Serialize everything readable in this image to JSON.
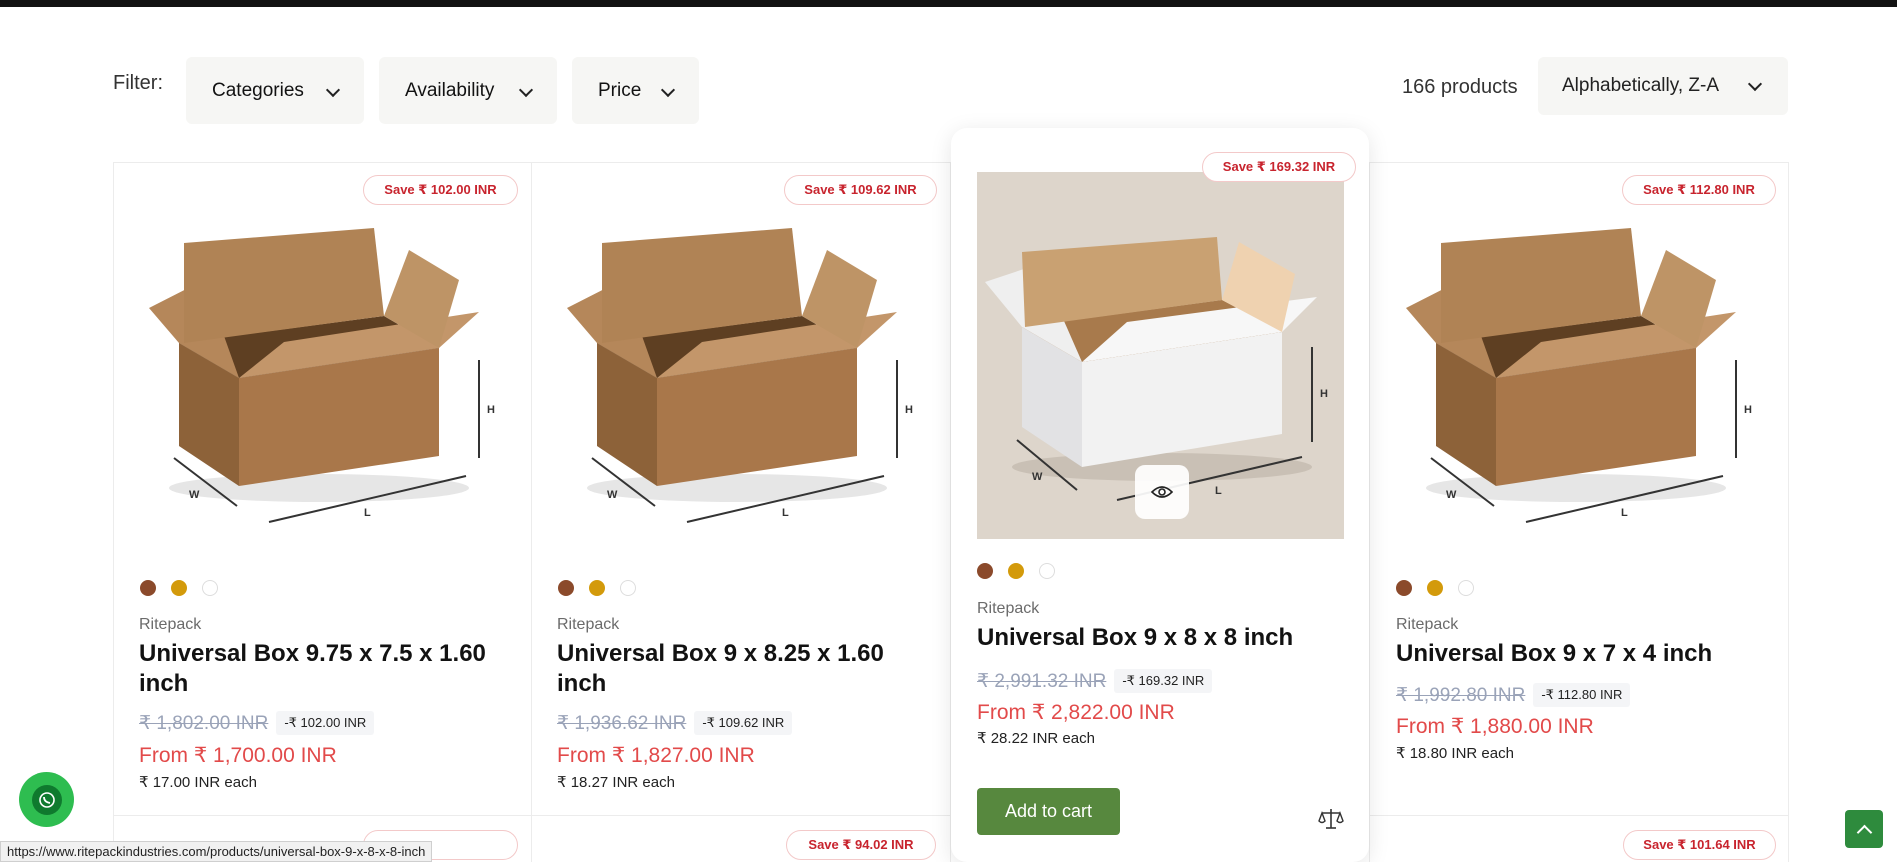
{
  "filter": {
    "label": "Filter:",
    "buttons": [
      {
        "label": "Categories"
      },
      {
        "label": "Availability"
      },
      {
        "label": "Price"
      }
    ]
  },
  "product_count": "166 products",
  "sort": {
    "selected": "Alphabetically, Z-A"
  },
  "products": [
    {
      "badge": "Save ₹ 102.00 INR",
      "vendor": "Ritepack",
      "title": "Universal Box 9.75 x 7.5 x 1.60 inch",
      "compare_price": "₹ 1,802.00 INR",
      "discount": "-₹ 102.00 INR",
      "price": "From ₹ 1,700.00 INR",
      "unit_price": "₹ 17.00 INR each",
      "box_color": "brown"
    },
    {
      "badge": "Save ₹ 109.62 INR",
      "vendor": "Ritepack",
      "title": "Universal Box 9 x 8.25 x 1.60 inch",
      "compare_price": "₹ 1,936.62 INR",
      "discount": "-₹ 109.62 INR",
      "price": "From ₹ 1,827.00 INR",
      "unit_price": "₹ 18.27 INR each",
      "box_color": "brown"
    },
    {
      "badge": "Save ₹ 169.32 INR",
      "vendor": "Ritepack",
      "title": "Universal Box 9 x 8 x 8 inch",
      "compare_price": "₹ 2,991.32 INR",
      "discount": "-₹ 169.32 INR",
      "price": "From ₹ 2,822.00 INR",
      "unit_price": "₹ 28.22 INR each",
      "box_color": "white",
      "add_to_cart": "Add to cart"
    },
    {
      "badge": "Save ₹ 112.80 INR",
      "vendor": "Ritepack",
      "title": "Universal Box 9 x 7 x 4 inch",
      "compare_price": "₹ 1,992.80 INR",
      "discount": "-₹ 112.80 INR",
      "price": "From ₹ 1,880.00 INR",
      "unit_price": "₹ 18.80 INR each",
      "box_color": "brown"
    }
  ],
  "next_row_badges": [
    "Save ₹ 94.02 INR",
    "Save ₹ 101.64 INR"
  ],
  "status_url": "https://www.ritepackindustries.com/products/universal-box-9-x-8-x-8-inch",
  "colors": {
    "accent_green": "#57883e",
    "sale_red": "#e24a4a",
    "badge_red": "#c8242e",
    "whatsapp": "#2ebd50"
  },
  "icons": [
    "chevron-down-icon",
    "eye-icon",
    "compare-scale-icon",
    "whatsapp-icon",
    "arrow-up-icon"
  ]
}
